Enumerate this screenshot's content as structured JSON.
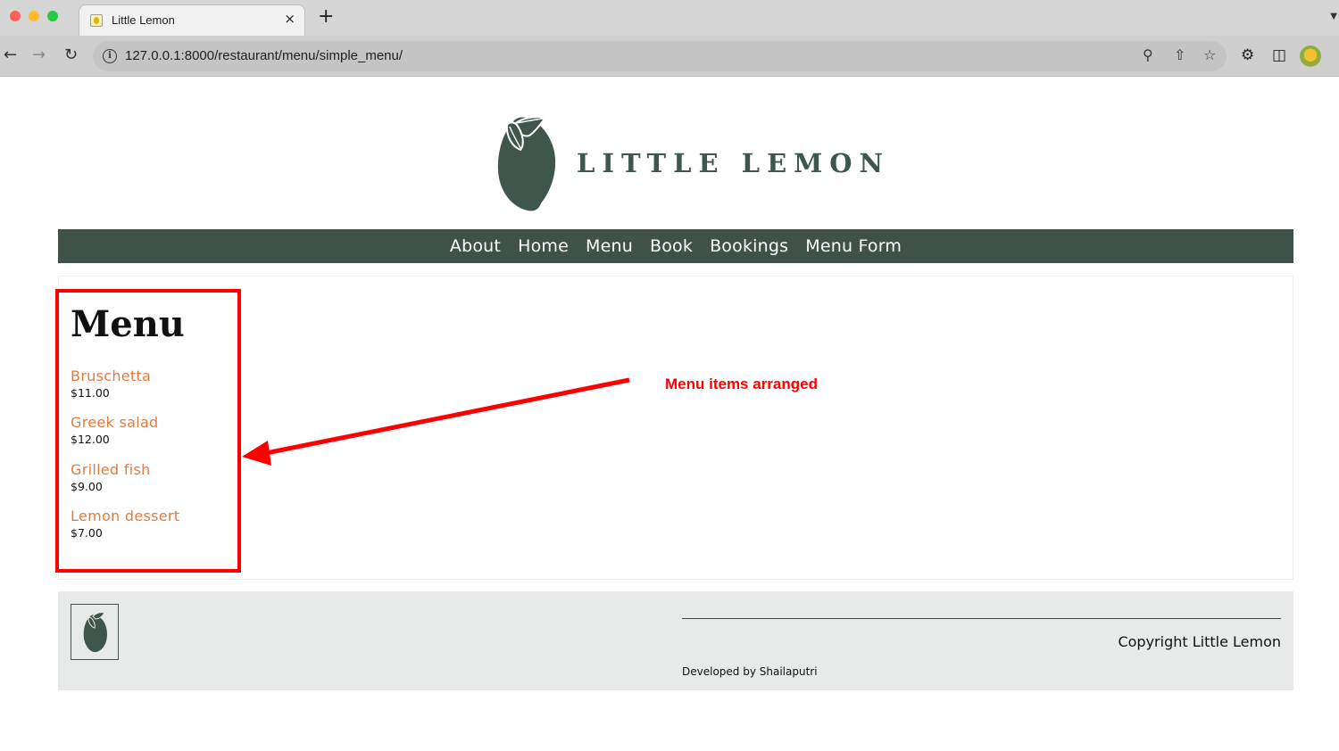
{
  "browser": {
    "tab_title": "Little Lemon",
    "tab_close": "×",
    "new_tab": "+",
    "url": "127.0.0.1:8000/restaurant/menu/simple_menu/",
    "icons": [
      "back-arrow-icon",
      "forward-arrow-icon",
      "reload-icon",
      "site-info-icon",
      "zoom-icon",
      "share-icon",
      "bookmark-star-icon",
      "extensions-puzzle-icon",
      "side-panel-icon",
      "profile-avatar"
    ]
  },
  "header": {
    "brand": "LITTLE LEMON",
    "logo_icon": "lemon-icon"
  },
  "nav": {
    "items": [
      "About",
      "Home",
      "Menu",
      "Book",
      "Bookings",
      "Menu Form"
    ]
  },
  "menu": {
    "title": "Menu",
    "items": [
      {
        "name": "Bruschetta",
        "price": "$11.00"
      },
      {
        "name": "Greek salad",
        "price": "$12.00"
      },
      {
        "name": "Grilled fish",
        "price": "$9.00"
      },
      {
        "name": "Lemon dessert",
        "price": "$7.00"
      }
    ]
  },
  "annotation": {
    "label": "Menu items arranged",
    "color": "#ff0000"
  },
  "footer": {
    "copyright": "Copyright Little Lemon",
    "developer": "Developed by Shailaputri"
  },
  "colors": {
    "brand_green": "#3f5249",
    "item_orange": "#e07b3f",
    "footer_bg": "#e7eae8"
  }
}
